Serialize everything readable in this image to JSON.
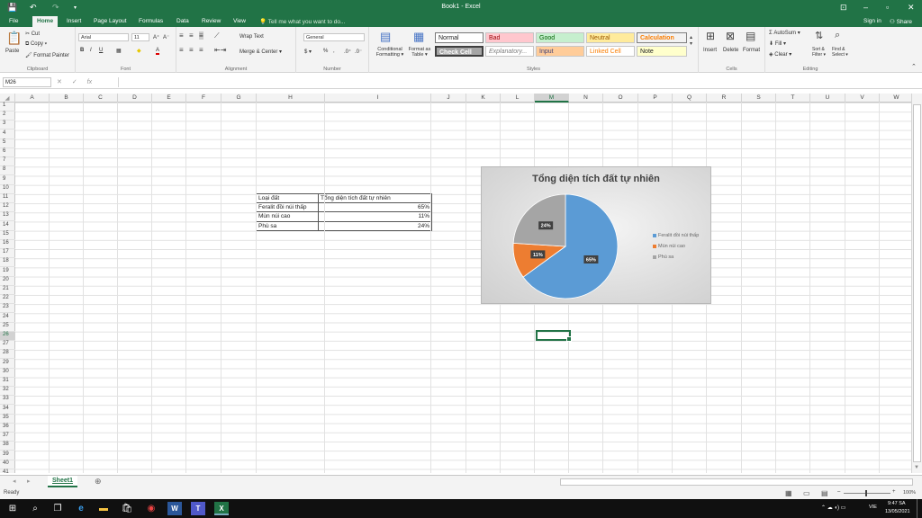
{
  "titlebar": {
    "title": "Book1 - Excel",
    "save": "💾",
    "undo": "↶",
    "redo": "↷",
    "qa_more": "▾",
    "opt": "⊡",
    "min": "–",
    "max": "▫",
    "close": "✕"
  },
  "tabs": [
    {
      "label": "File"
    },
    {
      "label": "Home"
    },
    {
      "label": "Insert"
    },
    {
      "label": "Page Layout"
    },
    {
      "label": "Formulas"
    },
    {
      "label": "Data"
    },
    {
      "label": "Review"
    },
    {
      "label": "View"
    }
  ],
  "tellme": "💡 Tell me what you want to do...",
  "signin": "Sign in",
  "share": "⚇ Share",
  "ribbon": {
    "clipboard": {
      "label": "Clipboard",
      "paste": "Paste",
      "cut": "✂ Cut",
      "copy": "⧉ Copy ▾",
      "painter": "🖌 Format Painter"
    },
    "font": {
      "label": "Font",
      "name": "Arial",
      "size": "11",
      "grow": "A⁺",
      "shrink": "A⁻",
      "bold": "B",
      "italic": "I",
      "underline": "U",
      "border": "▦",
      "fill": "◆",
      "color": "A"
    },
    "alignment": {
      "label": "Alignment",
      "wrap": "Wrap Text",
      "merge": "Merge & Center ▾"
    },
    "number": {
      "label": "Number",
      "format": "General",
      "currency": "$ ▾",
      "percent": "%",
      "comma": ",",
      "inc": ".0⁺",
      "dec": ".0⁻"
    },
    "styles": {
      "label": "Styles",
      "cond": "Conditional Formatting ▾",
      "table": "Format as Table ▾",
      "cells": [
        {
          "label": "Normal"
        },
        {
          "label": "Bad"
        },
        {
          "label": "Good"
        },
        {
          "label": "Neutral"
        },
        {
          "label": "Calculation"
        },
        {
          "label": "Check Cell"
        },
        {
          "label": "Explanatory..."
        },
        {
          "label": "Input"
        },
        {
          "label": "Linked Cell"
        },
        {
          "label": "Note"
        }
      ]
    },
    "cells": {
      "label": "Cells",
      "insert": "Insert",
      "delete": "Delete",
      "format": "Format"
    },
    "editing": {
      "label": "Editing",
      "autosum": "Σ AutoSum ▾",
      "fill": "⬇ Fill ▾",
      "clear": "◈ Clear ▾",
      "sort": "Sort & Filter ▾",
      "find": "Find & Select ▾"
    }
  },
  "formula_bar": {
    "name_box": "M26",
    "cancel": "✕",
    "enter": "✓",
    "fx": "fx",
    "value": ""
  },
  "columns": [
    "A",
    "B",
    "C",
    "D",
    "E",
    "F",
    "G",
    "H",
    "I",
    "J",
    "K",
    "L",
    "M",
    "N",
    "O",
    "P",
    "Q",
    "R",
    "S",
    "T",
    "U",
    "V",
    "W"
  ],
  "selected_column": "M",
  "selected_row": "26",
  "table": {
    "header": [
      "Loại đất",
      "Tổng diện tích đất tự nhiên"
    ],
    "rows": [
      [
        "Feralit đồi núi thấp",
        "65%"
      ],
      [
        "Mùn núi cao",
        "11%"
      ],
      [
        "Phù sa",
        "24%"
      ]
    ]
  },
  "chart_data": {
    "type": "pie",
    "title": "Tổng diện tích đất tự nhiên",
    "categories": [
      "Feralit đồi núi thấp",
      "Mùn núi cao",
      "Phù sa"
    ],
    "values": [
      65,
      11,
      24
    ],
    "data_labels": [
      "65%",
      "11%",
      "24%"
    ],
    "colors": [
      "#5b9bd5",
      "#ed7d31",
      "#a5a5a5"
    ],
    "legend": "right"
  },
  "sheet": {
    "name": "Sheet1",
    "add": "⊕",
    "prev": "◂",
    "next": "▸"
  },
  "status": {
    "ready": "Ready",
    "zoom": "100%",
    "minus": "–",
    "plus": "+"
  },
  "taskbar": {
    "lang": "VIE",
    "time": "9:47 SA",
    "date": "13/05/2021"
  }
}
